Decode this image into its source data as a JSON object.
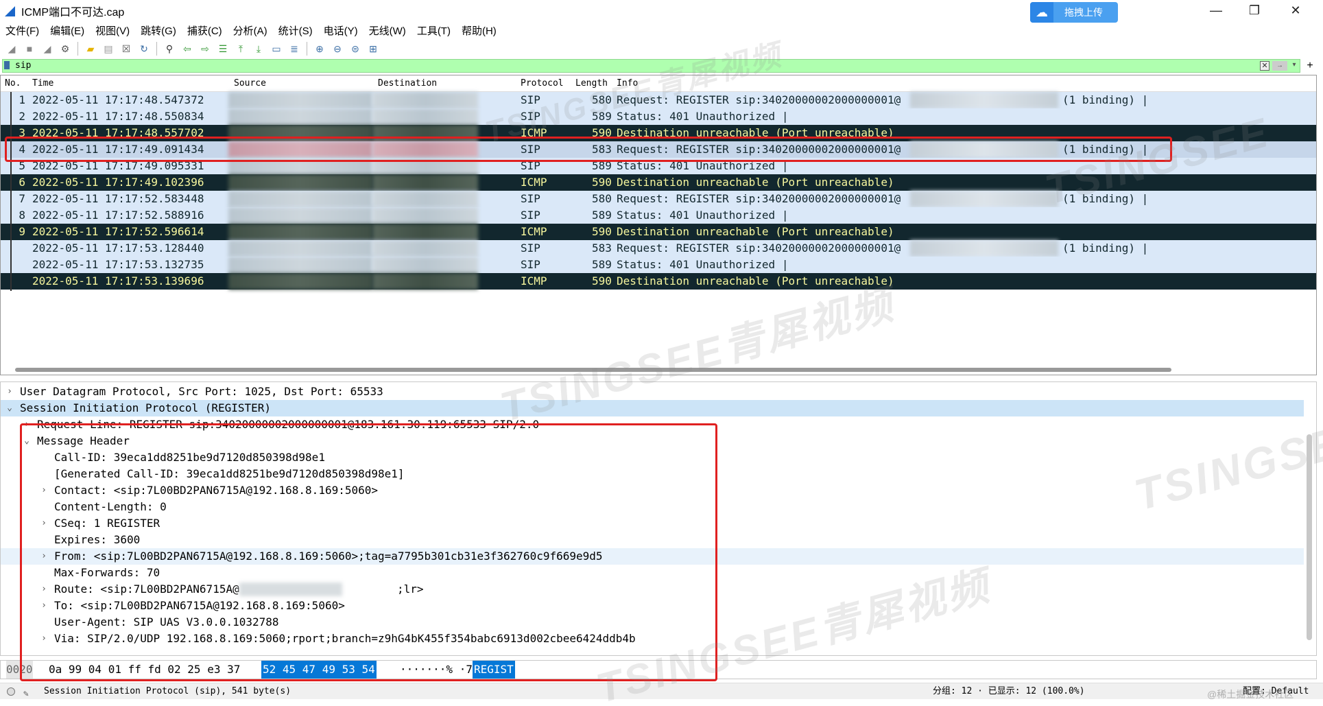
{
  "window": {
    "title": "ICMP端口不可达.cap",
    "upload_label": "拖拽上传",
    "minimize": "—",
    "maximize": "❐",
    "close": "✕"
  },
  "menu": [
    "文件(F)",
    "编辑(E)",
    "视图(V)",
    "跳转(G)",
    "捕获(C)",
    "分析(A)",
    "统计(S)",
    "电话(Y)",
    "无线(W)",
    "工具(T)",
    "帮助(H)"
  ],
  "toolbar_icons": [
    "shark-fin-start-icon",
    "stop-icon",
    "restart-icon",
    "options-gear-icon",
    "open-folder-icon",
    "save-file-icon",
    "close-file-icon",
    "reload-icon",
    "find-icon",
    "back-arrow-icon",
    "forward-arrow-icon",
    "goto-packet-icon",
    "first-packet-icon",
    "last-packet-icon",
    "autoscroll-icon",
    "colorize-icon",
    "zoom-in-icon",
    "zoom-out-icon",
    "normal-size-icon",
    "resize-columns-icon"
  ],
  "filter": {
    "value": "sip",
    "clear": "✕",
    "apply": "→",
    "dropdown": "▾",
    "add": "+"
  },
  "packet_list": {
    "columns": {
      "no": "No.",
      "time": "Time",
      "source": "Source",
      "destination": "Destination",
      "protocol": "Protocol",
      "length": "Length",
      "info": "Info"
    },
    "rows": [
      {
        "no": "1",
        "time": "2022-05-11 17:17:48.547372",
        "protocol": "SIP",
        "length": "580",
        "info": "Request: REGISTER sip:34020000002000000001@",
        "binding": "(1 binding) |",
        "kind": "sip"
      },
      {
        "no": "2",
        "time": "2022-05-11 17:17:48.550834",
        "protocol": "SIP",
        "length": "589",
        "info": "Status: 401 Unauthorized |",
        "binding": "",
        "kind": "sip"
      },
      {
        "no": "3",
        "time": "2022-05-11 17:17:48.557702",
        "protocol": "ICMP",
        "length": "590",
        "info": "Destination unreachable (Port unreachable)",
        "binding": "",
        "kind": "icmp"
      },
      {
        "no": "4",
        "time": "2022-05-11 17:17:49.091434",
        "protocol": "SIP",
        "length": "583",
        "info": "Request: REGISTER sip:34020000002000000001@",
        "binding": "(1 binding) |",
        "kind": "selected"
      },
      {
        "no": "5",
        "time": "2022-05-11 17:17:49.095331",
        "protocol": "SIP",
        "length": "589",
        "info": "Status: 401 Unauthorized |",
        "binding": "",
        "kind": "sip"
      },
      {
        "no": "6",
        "time": "2022-05-11 17:17:49.102396",
        "protocol": "ICMP",
        "length": "590",
        "info": "Destination unreachable (Port unreachable)",
        "binding": "",
        "kind": "icmp"
      },
      {
        "no": "7",
        "time": "2022-05-11 17:17:52.583448",
        "protocol": "SIP",
        "length": "580",
        "info": "Request: REGISTER sip:34020000002000000001@",
        "binding": "(1 binding) |",
        "kind": "sip"
      },
      {
        "no": "8",
        "time": "2022-05-11 17:17:52.588916",
        "protocol": "SIP",
        "length": "589",
        "info": "Status: 401 Unauthorized |",
        "binding": "",
        "kind": "sip"
      },
      {
        "no": "9",
        "time": "2022-05-11 17:17:52.596614",
        "protocol": "ICMP",
        "length": "590",
        "info": "Destination unreachable (Port unreachable)",
        "binding": "",
        "kind": "icmp"
      },
      {
        "no": "",
        "time": "2022-05-11 17:17:53.128440",
        "protocol": "SIP",
        "length": "583",
        "info": "Request: REGISTER sip:34020000002000000001@",
        "binding": "(1 binding) |",
        "kind": "sip"
      },
      {
        "no": "",
        "time": "2022-05-11 17:17:53.132735",
        "protocol": "SIP",
        "length": "589",
        "info": "Status: 401 Unauthorized |",
        "binding": "",
        "kind": "sip"
      },
      {
        "no": "",
        "time": "2022-05-11 17:17:53.139696",
        "protocol": "ICMP",
        "length": "590",
        "info": "Destination unreachable (Port unreachable)",
        "binding": "",
        "kind": "icmp"
      }
    ]
  },
  "details": {
    "lines": [
      {
        "arrow": "›",
        "text": "User Datagram Protocol, Src Port: 1025, Dst Port: 65533",
        "indent": 0,
        "hl": ""
      },
      {
        "arrow": "⌄",
        "text": "Session Initiation Protocol (REGISTER)",
        "indent": 0,
        "hl": "hl"
      },
      {
        "arrow": "›",
        "text": "Request-Line: REGISTER sip:34020000002000000001@183.161.30.119:65533 SIP/2.0",
        "indent": 1,
        "hl": ""
      },
      {
        "arrow": "⌄",
        "text": "Message Header",
        "indent": 1,
        "hl": ""
      },
      {
        "arrow": "",
        "text": "Call-ID: 39eca1dd8251be9d7120d850398d98e1",
        "indent": 2,
        "hl": ""
      },
      {
        "arrow": "",
        "text": "[Generated Call-ID: 39eca1dd8251be9d7120d850398d98e1]",
        "indent": 2,
        "hl": ""
      },
      {
        "arrow": "›",
        "text": "Contact: <sip:7L00BD2PAN6715A@192.168.8.169:5060>",
        "indent": 2,
        "hl": ""
      },
      {
        "arrow": "",
        "text": "Content-Length: 0",
        "indent": 2,
        "hl": ""
      },
      {
        "arrow": "›",
        "text": "CSeq: 1 REGISTER",
        "indent": 2,
        "hl": ""
      },
      {
        "arrow": "",
        "text": "Expires: 3600",
        "indent": 2,
        "hl": ""
      },
      {
        "arrow": "›",
        "text": "From: <sip:7L00BD2PAN6715A@192.168.8.169:5060>;tag=a7795b301cb31e3f362760c9f669e9d5",
        "indent": 2,
        "hl": "hl2"
      },
      {
        "arrow": "",
        "text": "Max-Forwards: 70",
        "indent": 2,
        "hl": ""
      },
      {
        "arrow": "›",
        "text": "Route: <sip:7L00BD2PAN6715A@",
        "suffix": ";lr>",
        "indent": 2,
        "hl": ""
      },
      {
        "arrow": "›",
        "text": "To: <sip:7L00BD2PAN6715A@192.168.8.169:5060>",
        "indent": 2,
        "hl": ""
      },
      {
        "arrow": "",
        "text": "User-Agent: SIP UAS V3.0.0.1032788",
        "indent": 2,
        "hl": ""
      },
      {
        "arrow": "›",
        "text": "Via: SIP/2.0/UDP 192.168.8.169:5060;rport;branch=z9hG4bK455f354babc6913d002cbee6424ddb4b",
        "indent": 2,
        "hl": ""
      }
    ]
  },
  "bytes": {
    "offset": "0020",
    "hex_plain": "0a 99 04 01 ff fd 02 25  e3 37",
    "hex_selected": "52 45 47 49 53 54",
    "ascii_plain": "·······% ·7",
    "ascii_selected": "REGIST"
  },
  "status": {
    "text": "Session Initiation Protocol (sip), 541 byte(s)",
    "groups": "分组: 12 · 已显示: 12 (100.0%)",
    "profile": "配置: Default"
  },
  "colors": {
    "sip_row": "#dae8f8",
    "icmp_row": "#12272e",
    "icmp_text": "#f7f79e",
    "filter_ok": "#afffaf",
    "annotation": "#e02020"
  },
  "watermark": {
    "brand": "TSINGSEE",
    "cn": "青犀视频",
    "source": "@稀土掘金技术社区"
  }
}
